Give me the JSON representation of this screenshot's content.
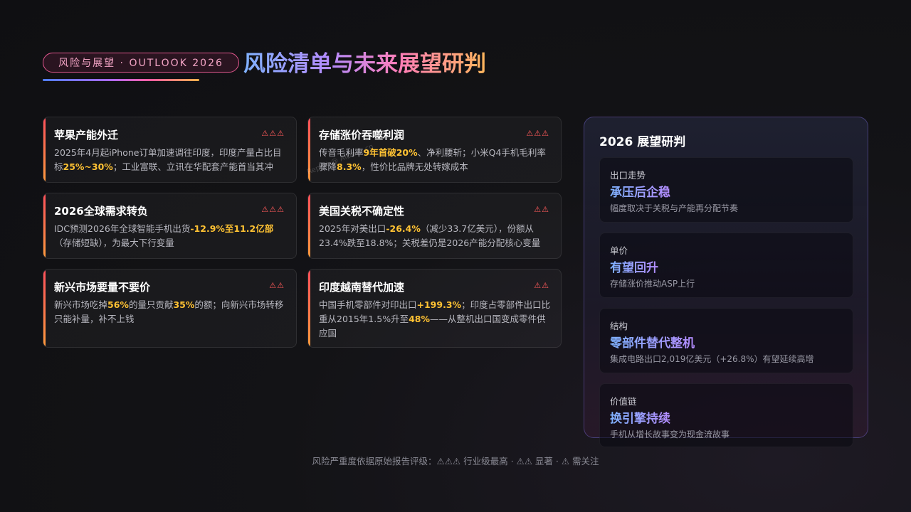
{
  "header": {
    "tag": "风险与展望 · OUTLOOK 2026",
    "title": "风险清单与未来展望研判"
  },
  "risks": [
    {
      "title": "苹果产能外迁",
      "severity": "⚠⚠⚠",
      "level": 3,
      "body": [
        {
          "t": "2025年4月起iPhone订单加速调往印度，印度产量占比目标"
        },
        {
          "t": "25%~30%",
          "h": true
        },
        {
          "t": "；工业富联、立讯在华配套产能首当其冲"
        }
      ]
    },
    {
      "title": "存储涨价吞噬利润",
      "severity": "⚠⚠⚠",
      "level": 3,
      "body": [
        {
          "t": "传音毛利率"
        },
        {
          "t": "9年首破20%",
          "h": true
        },
        {
          "t": "、净利腰斩；小米Q4手机毛利率骤降"
        },
        {
          "t": "8.3%",
          "h": true
        },
        {
          "t": "，性价比品牌无处转嫁成本"
        }
      ]
    },
    {
      "title": "2026全球需求转负",
      "severity": "⚠⚠⚠",
      "level": 3,
      "body": [
        {
          "t": "IDC预测2026年全球智能手机出货"
        },
        {
          "t": "-12.9%至11.2亿部",
          "h": true
        },
        {
          "t": "（存储短缺），为最大下行变量"
        }
      ]
    },
    {
      "title": "美国关税不确定性",
      "severity": "⚠⚠",
      "level": 2,
      "body": [
        {
          "t": "2025年对美出口"
        },
        {
          "t": "-26.4%",
          "h": true
        },
        {
          "t": "（减少33.7亿美元），份额从23.4%跌至18.8%；关税差仍是2026产能分配核心变量"
        }
      ]
    },
    {
      "title": "新兴市场要量不要价",
      "severity": "⚠⚠",
      "level": 2,
      "body": [
        {
          "t": "新兴市场吃掉"
        },
        {
          "t": "56%",
          "h": true
        },
        {
          "t": "的量只贡献"
        },
        {
          "t": "35%",
          "h": true
        },
        {
          "t": "的额；向新兴市场转移只能补量，补不上钱"
        }
      ]
    },
    {
      "title": "印度越南替代加速",
      "severity": "⚠⚠",
      "level": 2,
      "body": [
        {
          "t": "中国手机零部件对印出口"
        },
        {
          "t": "+199.3%",
          "h": true
        },
        {
          "t": "；印度占零部件出口比重从2015年1.5%升至"
        },
        {
          "t": "48%",
          "h": true
        },
        {
          "t": "——从整机出口国变成零件供应国"
        }
      ]
    }
  ],
  "outlook": {
    "title": "2026 展望研判",
    "items": [
      {
        "label": "出口走势",
        "value": "承压后企稳",
        "desc": "幅度取决于关税与产能再分配节奏"
      },
      {
        "label": "单价",
        "value": "有望回升",
        "desc": "存储涨价推动ASP上行"
      },
      {
        "label": "结构",
        "value": "零部件替代整机",
        "desc": "集成电路出口2,019亿美元（+26.8%）有望延续高增"
      },
      {
        "label": "价值链",
        "value": "换引擎持续",
        "desc": "手机从增长故事变为现金流故事"
      }
    ]
  },
  "footer": "风险严重度依据原始报告评级：⚠⚠⚠ 行业级最高 · ⚠⚠ 显著 · ⚠ 需关注",
  "watermark": "Report @ AIDeck.cn",
  "colors": {
    "highlight": "#ffc233",
    "severity": "#ff5a5a",
    "accent_from": "#7fb2ff",
    "accent_to": "#ffb65c"
  }
}
